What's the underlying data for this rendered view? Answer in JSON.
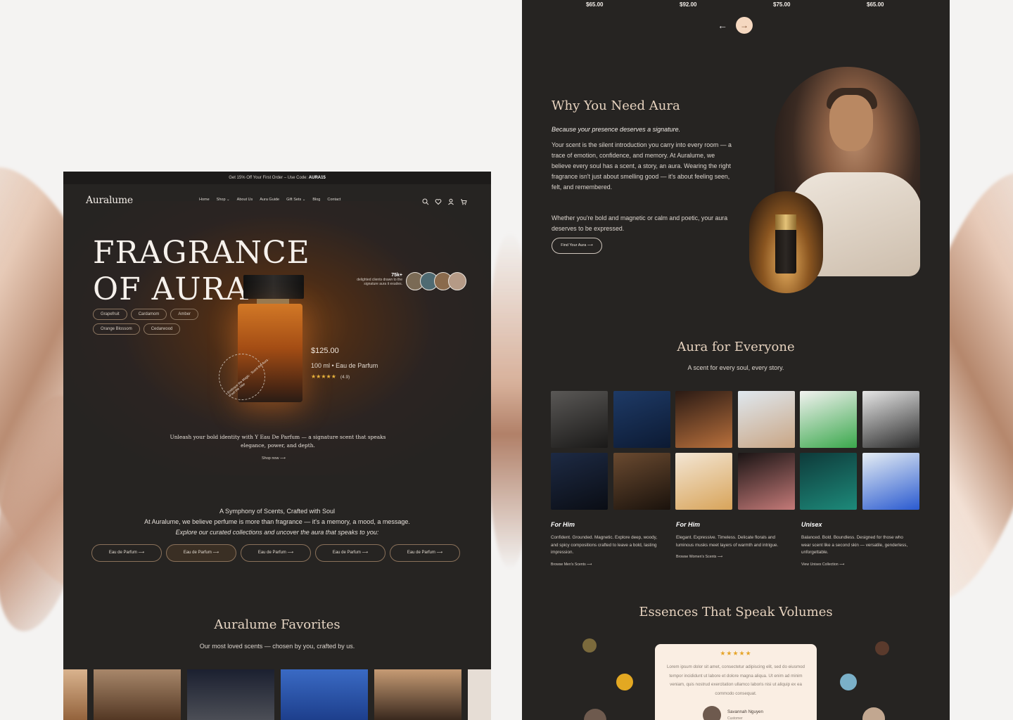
{
  "left": {
    "promo": {
      "text": "Get 15% Off Your First Order – Use Code: ",
      "code": "AURA15"
    },
    "logo": "Auralume",
    "menu": [
      "Home",
      "Shop ⌄",
      "About Us",
      "Aura Guide",
      "Gift Sets ⌄",
      "Blog",
      "Contact"
    ],
    "hero": {
      "title_line1": "FRAGRANCE",
      "title_line2": "OF AURA",
      "tags": [
        "Grapefruit",
        "Cardamom",
        "Amber",
        "Orange Blossom",
        "Cedarwood"
      ],
      "price": "$125.00",
      "volume": "100 ml • Eau de Parfum",
      "stars": "★★★★★",
      "rating": "(4.9)",
      "ring_text": "Embrace the Magic · Scent the Aura · Feel the Vibe",
      "clients_count": "75k+",
      "clients_text": "delighted clients drawn to the signature aura it exudes.",
      "description": "Unleash your bold identity with Y Eau De Parfum — a signature scent that speaks elegance, power, and depth.",
      "shop_now": "Shop now"
    },
    "symphony": {
      "line1": "A Symphony of Scents, Crafted with Soul",
      "line2": "At Auralume, we believe perfume is more than fragrance — it's a memory, a mood, a message.",
      "line3": "Explore our curated collections and uncover the aura that speaks to you:"
    },
    "pills": [
      "Eau de Parfum",
      "Eau de Parfum",
      "Eau de Parfum",
      "Eau de Parfum",
      "Eau de Parfum"
    ],
    "favorites": {
      "title": "Auralume Favorites",
      "subtitle": "Our most loved scents — chosen by you, crafted by us."
    }
  },
  "right": {
    "prices": [
      "$65.00",
      "$92.00",
      "$75.00",
      "$65.00"
    ],
    "why": {
      "title": "Why You Need Aura",
      "subtitle": "Because your presence deserves a signature.",
      "p1": "Your scent is the silent introduction you carry into every room — a trace of emotion, confidence, and memory. At Auralume, we believe every soul has a scent, a story, an aura. Wearing the right fragrance isn't just about smelling good — it's about feeling seen, felt, and remembered.",
      "p2": "Whether you're bold and magnetic or calm and poetic, your aura deserves to be expressed.",
      "button": "Find Your Aura"
    },
    "everyone": {
      "title": "Aura for Everyone",
      "subtitle": "A scent for every soul, every story."
    },
    "columns": [
      {
        "title": "For Him",
        "text": "Confident. Grounded. Magnetic. Explore deep, woody, and spicy compositions crafted to leave a bold, lasting impression.",
        "link": "Browse Men's Scents"
      },
      {
        "title": "For Him",
        "text": "Elegant. Expressive. Timeless. Delicate florals and luminous musks meet layers of warmth and intrigue.",
        "link": "Browse Women's Scents"
      },
      {
        "title": "Unisex",
        "text": "Balanced. Bold. Boundless. Designed for those who wear scent like a second skin — versatile, genderless, unforgettable.",
        "link": "View Unisex Collection"
      }
    ],
    "essences": {
      "title": "Essences That Speak Volumes",
      "stars": "★★★★★",
      "review": "Lorem ipsum dolor sit amet, consectetur adipiscing elit, sed do eiusmod tempor incididunt ut labore et dolore magna aliqua. Ut enim ad minim veniam, quis nostrud exercitation ullamco laboris nisi ut aliquip ex ea commodo consequat.",
      "name": "Savannah Nguyen",
      "role": "Customer"
    }
  },
  "colors": {
    "panel": "#262422",
    "accent": "#e7d3bf",
    "gold": "#e8b23c"
  }
}
